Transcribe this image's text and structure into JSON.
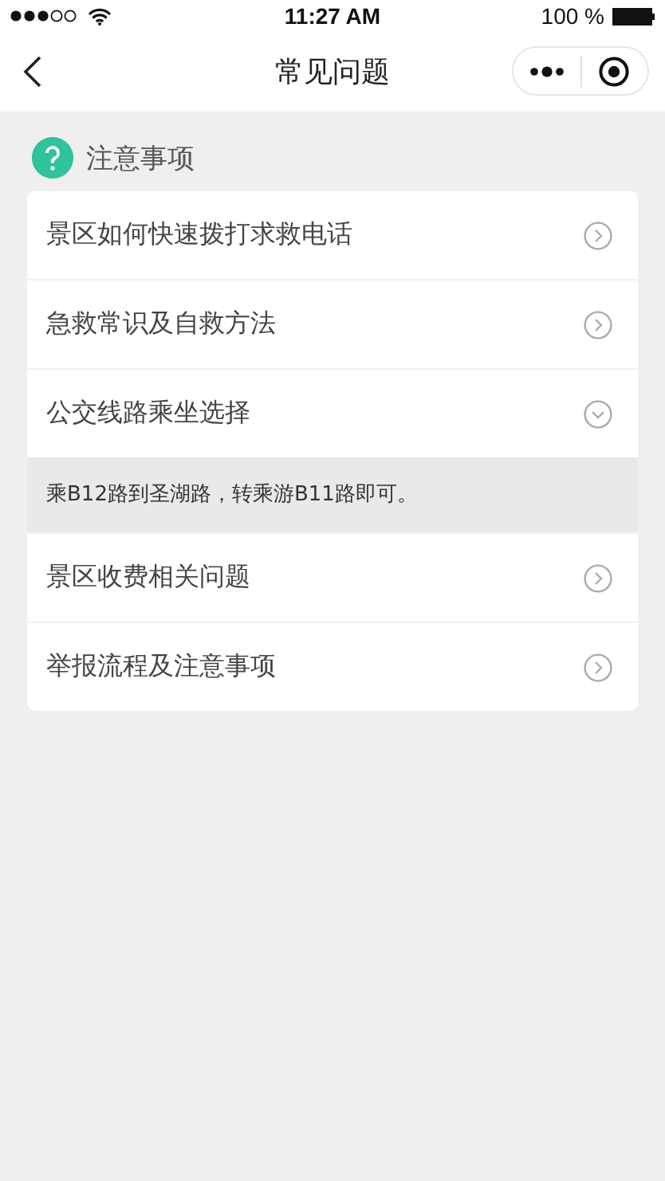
{
  "status_bar": {
    "time": "11:27 AM",
    "battery": "100 %"
  },
  "nav_bar": {
    "title": "常见问题"
  },
  "section": {
    "title": "注意事项"
  },
  "faq": [
    {
      "question": "景区如何快速拨打求救电话",
      "expanded": false
    },
    {
      "question": "急救常识及自救方法",
      "expanded": false
    },
    {
      "question": "公交线路乘坐选择",
      "expanded": true,
      "answer": "乘B12路到圣湖路，转乘游B11路即可。"
    },
    {
      "question": "景区收费相关问题",
      "expanded": false
    },
    {
      "question": "举报流程及注意事项",
      "expanded": false
    }
  ]
}
